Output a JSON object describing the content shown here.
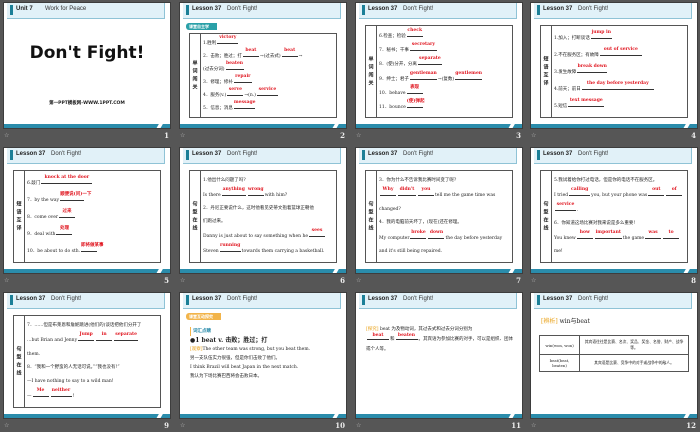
{
  "colors": {
    "accent": "#2a8cab",
    "answer": "#e0141e",
    "header_bg": "#e1f1f8"
  },
  "slides": [
    {
      "num": "1",
      "header": [
        "Unit 7",
        "Work  for  Peace"
      ],
      "title": "Don't Fight!",
      "footer": "第一PPT模板网-WWW.1PPT.COM"
    },
    {
      "num": "2",
      "header": [
        "Lesson 37",
        "Don't Fight!"
      ],
      "tag": "课堂自主学",
      "label": "单词闯关",
      "lines": [
        [
          "1.胜利",
          {
            "a": "victory"
          }
        ],
        [
          "2．击败；胜过；打",
          {
            "a": "beat"
          },
          "→(过去式)",
          {
            "a": "beat"
          },
          "→"
        ],
        [
          "(过去分词)",
          {
            "a": "beaten"
          }
        ],
        [
          "3．修理；修补",
          {
            "a": "repair"
          }
        ],
        [
          "4．服务(v.)",
          {
            "a": "serve"
          },
          "→(n.)",
          {
            "a": "service"
          }
        ],
        [
          "5．信息；消息",
          {
            "a": "message"
          }
        ]
      ]
    },
    {
      "num": "3",
      "header": [
        "Lesson 37",
        "Don't Fight!"
      ],
      "label": "单词闯关",
      "lines": [
        [
          "6.检查；检验",
          {
            "a": "check"
          }
        ],
        [
          "7．秘书；干事",
          {
            "a": "secretary"
          }
        ],
        [
          "8．(使)分开，分离",
          {
            "a": "separate"
          }
        ],
        [
          "9．绅士；君子",
          {
            "a": "gentleman"
          },
          "→(复数)",
          {
            "a": "gentlemen"
          }
        ],
        [
          "10．behave",
          {
            "a": "表现"
          }
        ],
        [
          "11．bounce",
          {
            "a": "(使)弹起"
          }
        ]
      ]
    },
    {
      "num": "4",
      "header": [
        "Lesson 37",
        "Don't Fight!"
      ],
      "label": "短语互译",
      "lines": [
        [
          "1.加入；打断谈话",
          {
            "a": "jump in"
          }
        ],
        [
          "2.不在服务区；有故障",
          {
            "a": "out of service"
          }
        ],
        [
          "3.发生故障",
          {
            "a": "break down"
          }
        ],
        [
          "4.前天；前日",
          {
            "a": "the day before yesterday"
          }
        ],
        [
          "5.短信",
          {
            "a": "text message"
          }
        ]
      ]
    },
    {
      "num": "5",
      "header": [
        "Lesson 37",
        "Don't Fight!"
      ],
      "label": "短语互译",
      "lines": [
        [
          "6.敲门",
          {
            "a": "knock at the door"
          }
        ],
        [
          "7．by the way",
          {
            "a": "顺便说(问)一下"
          }
        ],
        [
          "8．come over",
          {
            "a": "过来"
          }
        ],
        [
          "9．deal with",
          {
            "a": "处理"
          }
        ],
        [
          "10．be about to do sth.",
          {
            "a": "即将做某事"
          }
        ]
      ]
    },
    {
      "num": "6",
      "header": [
        "Lesson 37",
        "Don't Fight!"
      ],
      "label": "句型在线",
      "lines": [
        [
          "1.他出什么问题了吗?"
        ],
        [
          "Is there",
          {
            "a": "anything"
          },
          {
            "a": "wrong"
          },
          "with him?"
        ],
        [
          "2．丹尼正要说什么，这时他看见史蒂文抱着篮球正朝他"
        ],
        [
          "们跑过来。"
        ],
        [
          "Danny is just about to say something when he",
          {
            "a": "sees"
          }
        ],
        [
          "Steven",
          {
            "a": "running"
          },
          "towards them carrying a basketball."
        ]
      ]
    },
    {
      "num": "7",
      "header": [
        "Lesson 37",
        "Don't Fight!"
      ],
      "label": "句型在线",
      "lines": [
        [
          "3．你为什么不告诉我比赛时间变了呢?"
        ],
        [
          {
            "a": "Why"
          },
          {
            "a": "didn't"
          },
          {
            "a": "you"
          },
          "tell me the game time was"
        ],
        [
          "changed?"
        ],
        [
          "4．我的电脑前天坏了，(现在)还在修理。"
        ],
        [
          "My computer",
          {
            "a": "broke"
          },
          {
            "a": "down"
          },
          "the day before yesterday"
        ],
        [
          "and it's still being repaired."
        ]
      ]
    },
    {
      "num": "8",
      "header": [
        "Lesson 37",
        "Don't Fight!"
      ],
      "label": "句型在线",
      "lines": [
        [
          "5.我试着给你打过电话，但是你的电话不在服务区。"
        ],
        [
          "I tried",
          {
            "a": "calling"
          },
          "you, but your phone was",
          {
            "a": "out"
          },
          {
            "a": "of"
          }
        ],
        [
          {
            "a": "service"
          },
          "."
        ],
        [
          "6．你知道这场比赛对我来说是多么重要!"
        ],
        [
          "You knew",
          {
            "a": "how"
          },
          {
            "a": "important"
          },
          "the game",
          {
            "a": "was"
          },
          {
            "a": "to"
          }
        ],
        [
          "me!"
        ]
      ]
    },
    {
      "num": "9",
      "header": [
        "Lesson 37",
        "Don't Fight!"
      ],
      "label": "句型在线",
      "lines": [
        [
          "7．……但是布莱恩和詹妮跳进(他们的)谈话把他们分开了"
        ],
        [
          "…but Brian and Jenny",
          {
            "a": "Jump"
          },
          {
            "a": "in"
          },
          {
            "a": "separate"
          }
        ],
        [
          "them."
        ],
        [
          "8．“我和一个野蛮的人无话可说。”“我也没有!”"
        ],
        [
          "—I have nothing to say to a wild man!"
        ],
        [
          "—",
          {
            "a": "Me"
          },
          {
            "a": "neither"
          },
          "!"
        ]
      ]
    },
    {
      "num": "10",
      "header": [
        "Lesson 37",
        "Don't Fight!"
      ],
      "tag": "课堂互动探究",
      "subhead": "词汇点睛",
      "item": "●1  beat v. 击败；胜过；打",
      "observe": "[观察]",
      "ex1": "The other team was strong, but you beat them.",
      "ex1_cn": "另一支队伍实力很强，但是你们击败了他们。",
      "ex2": "I think Brazil will beat Japan in the next match.",
      "ex2_cn": "我认为下场比赛巴西将会击败日本。"
    },
    {
      "num": "11",
      "header": [
        "Lesson 37",
        "Don't Fight!"
      ],
      "explore": "[探究]",
      "p1": " beat 为及物动词，其过去式和过去分词分别为",
      "a1": "beat",
      "mid": "和",
      "a2": "beaten",
      "p2": "。其宾语为参加比赛的对手，可以是组织、团体或个人等。"
    },
    {
      "num": "12",
      "header": [
        "Lesson 37",
        "Don't Fight!"
      ],
      "compare": "[辨析]",
      "compare_title": " win与beat",
      "table": [
        [
          "win(won, won)",
          "其宾语往往是比赛、名次、奖品、奖金、名誉、财产、战争等。"
        ],
        [
          "beat(beat, beaten)",
          "其宾语是比赛、竞争中的对手或战争中的敌人。"
        ]
      ]
    }
  ]
}
